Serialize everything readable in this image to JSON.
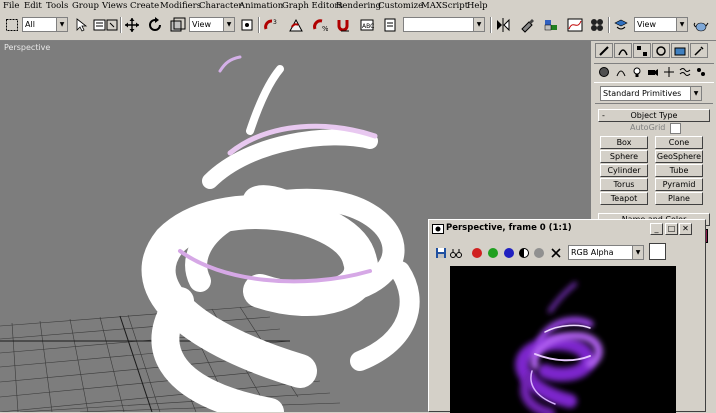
{
  "menu": [
    "File",
    "Edit",
    "Tools",
    "Group",
    "Views",
    "Create",
    "Modifiers",
    "Character",
    "Animation",
    "Graph Editors",
    "Rendering",
    "Customize",
    "MAXScript",
    "Help"
  ],
  "toolbar": {
    "selection_filter": "All",
    "ref_coord": "View",
    "named_selection": "",
    "view_combo": "View",
    "icons": [
      "select-region-icon",
      "select-icon",
      "select-by-name-icon",
      "select-move-icon",
      "select-rotate-icon",
      "select-scale-icon",
      "angle-snap-icon",
      "percent-snap-icon",
      "spinner-snap-icon",
      "mirror-icon",
      "align-icon",
      "material-editor-icon",
      "render-scene-icon",
      "quick-render-icon",
      "teapot-icon"
    ]
  },
  "viewport": {
    "label": "Perspective"
  },
  "command_panel": {
    "primitive_type": "Standard Primitives",
    "rollout_object_type": "Object Type",
    "autogrid": "AutoGrid",
    "buttons": [
      "Box",
      "Cone",
      "Sphere",
      "GeoSphere",
      "Cylinder",
      "Tube",
      "Torus",
      "Pyramid",
      "Teapot",
      "Plane"
    ],
    "rollout_name_color": "Name and Color"
  },
  "render_window": {
    "title": "Perspective, frame 0 (1:1)",
    "channel": "RGB Alpha",
    "colors": {
      "red": "#d02020",
      "green": "#20a020",
      "blue": "#2020c0"
    }
  }
}
